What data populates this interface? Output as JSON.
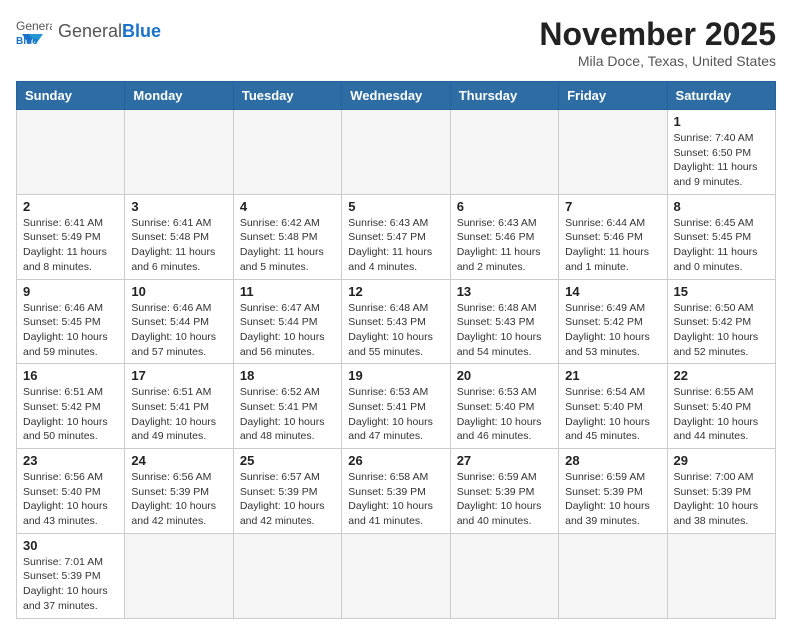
{
  "logo": {
    "text_general": "General",
    "text_blue": "Blue"
  },
  "header": {
    "month": "November 2025",
    "location": "Mila Doce, Texas, United States"
  },
  "weekdays": [
    "Sunday",
    "Monday",
    "Tuesday",
    "Wednesday",
    "Thursday",
    "Friday",
    "Saturday"
  ],
  "weeks": [
    [
      {
        "day": "",
        "info": ""
      },
      {
        "day": "",
        "info": ""
      },
      {
        "day": "",
        "info": ""
      },
      {
        "day": "",
        "info": ""
      },
      {
        "day": "",
        "info": ""
      },
      {
        "day": "",
        "info": ""
      },
      {
        "day": "1",
        "info": "Sunrise: 7:40 AM\nSunset: 6:50 PM\nDaylight: 11 hours and 9 minutes."
      }
    ],
    [
      {
        "day": "2",
        "info": "Sunrise: 6:41 AM\nSunset: 5:49 PM\nDaylight: 11 hours and 8 minutes."
      },
      {
        "day": "3",
        "info": "Sunrise: 6:41 AM\nSunset: 5:48 PM\nDaylight: 11 hours and 6 minutes."
      },
      {
        "day": "4",
        "info": "Sunrise: 6:42 AM\nSunset: 5:48 PM\nDaylight: 11 hours and 5 minutes."
      },
      {
        "day": "5",
        "info": "Sunrise: 6:43 AM\nSunset: 5:47 PM\nDaylight: 11 hours and 4 minutes."
      },
      {
        "day": "6",
        "info": "Sunrise: 6:43 AM\nSunset: 5:46 PM\nDaylight: 11 hours and 2 minutes."
      },
      {
        "day": "7",
        "info": "Sunrise: 6:44 AM\nSunset: 5:46 PM\nDaylight: 11 hours and 1 minute."
      },
      {
        "day": "8",
        "info": "Sunrise: 6:45 AM\nSunset: 5:45 PM\nDaylight: 11 hours and 0 minutes."
      }
    ],
    [
      {
        "day": "9",
        "info": "Sunrise: 6:46 AM\nSunset: 5:45 PM\nDaylight: 10 hours and 59 minutes."
      },
      {
        "day": "10",
        "info": "Sunrise: 6:46 AM\nSunset: 5:44 PM\nDaylight: 10 hours and 57 minutes."
      },
      {
        "day": "11",
        "info": "Sunrise: 6:47 AM\nSunset: 5:44 PM\nDaylight: 10 hours and 56 minutes."
      },
      {
        "day": "12",
        "info": "Sunrise: 6:48 AM\nSunset: 5:43 PM\nDaylight: 10 hours and 55 minutes."
      },
      {
        "day": "13",
        "info": "Sunrise: 6:48 AM\nSunset: 5:43 PM\nDaylight: 10 hours and 54 minutes."
      },
      {
        "day": "14",
        "info": "Sunrise: 6:49 AM\nSunset: 5:42 PM\nDaylight: 10 hours and 53 minutes."
      },
      {
        "day": "15",
        "info": "Sunrise: 6:50 AM\nSunset: 5:42 PM\nDaylight: 10 hours and 52 minutes."
      }
    ],
    [
      {
        "day": "16",
        "info": "Sunrise: 6:51 AM\nSunset: 5:42 PM\nDaylight: 10 hours and 50 minutes."
      },
      {
        "day": "17",
        "info": "Sunrise: 6:51 AM\nSunset: 5:41 PM\nDaylight: 10 hours and 49 minutes."
      },
      {
        "day": "18",
        "info": "Sunrise: 6:52 AM\nSunset: 5:41 PM\nDaylight: 10 hours and 48 minutes."
      },
      {
        "day": "19",
        "info": "Sunrise: 6:53 AM\nSunset: 5:41 PM\nDaylight: 10 hours and 47 minutes."
      },
      {
        "day": "20",
        "info": "Sunrise: 6:53 AM\nSunset: 5:40 PM\nDaylight: 10 hours and 46 minutes."
      },
      {
        "day": "21",
        "info": "Sunrise: 6:54 AM\nSunset: 5:40 PM\nDaylight: 10 hours and 45 minutes."
      },
      {
        "day": "22",
        "info": "Sunrise: 6:55 AM\nSunset: 5:40 PM\nDaylight: 10 hours and 44 minutes."
      }
    ],
    [
      {
        "day": "23",
        "info": "Sunrise: 6:56 AM\nSunset: 5:40 PM\nDaylight: 10 hours and 43 minutes."
      },
      {
        "day": "24",
        "info": "Sunrise: 6:56 AM\nSunset: 5:39 PM\nDaylight: 10 hours and 42 minutes."
      },
      {
        "day": "25",
        "info": "Sunrise: 6:57 AM\nSunset: 5:39 PM\nDaylight: 10 hours and 42 minutes."
      },
      {
        "day": "26",
        "info": "Sunrise: 6:58 AM\nSunset: 5:39 PM\nDaylight: 10 hours and 41 minutes."
      },
      {
        "day": "27",
        "info": "Sunrise: 6:59 AM\nSunset: 5:39 PM\nDaylight: 10 hours and 40 minutes."
      },
      {
        "day": "28",
        "info": "Sunrise: 6:59 AM\nSunset: 5:39 PM\nDaylight: 10 hours and 39 minutes."
      },
      {
        "day": "29",
        "info": "Sunrise: 7:00 AM\nSunset: 5:39 PM\nDaylight: 10 hours and 38 minutes."
      }
    ],
    [
      {
        "day": "30",
        "info": "Sunrise: 7:01 AM\nSunset: 5:39 PM\nDaylight: 10 hours and 37 minutes."
      },
      {
        "day": "",
        "info": ""
      },
      {
        "day": "",
        "info": ""
      },
      {
        "day": "",
        "info": ""
      },
      {
        "day": "",
        "info": ""
      },
      {
        "day": "",
        "info": ""
      },
      {
        "day": "",
        "info": ""
      }
    ]
  ]
}
